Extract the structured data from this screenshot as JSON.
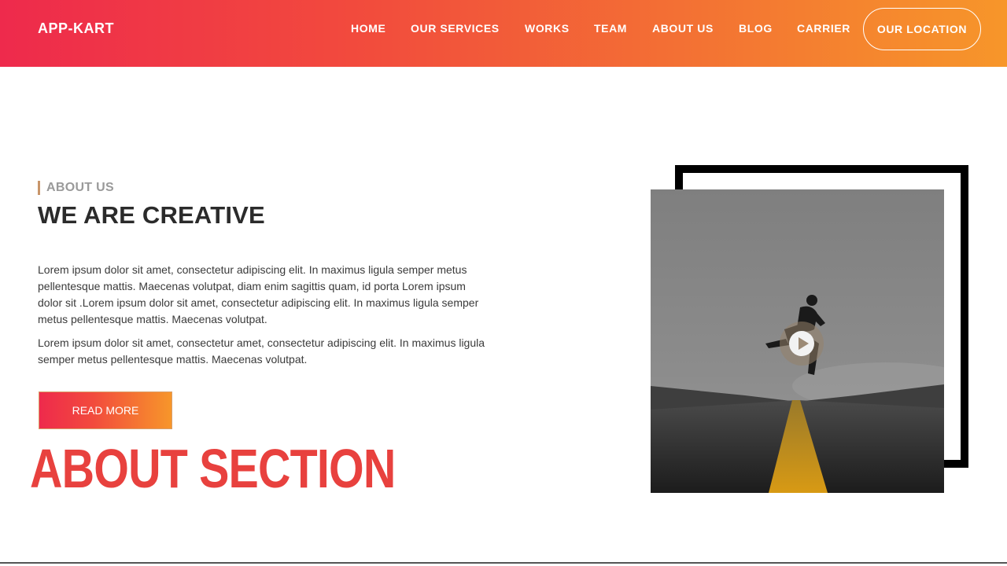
{
  "header": {
    "brand": "APP-KART",
    "nav": [
      {
        "label": "HOME"
      },
      {
        "label": "OUR SERVICES"
      },
      {
        "label": "WORKS"
      },
      {
        "label": "TEAM"
      },
      {
        "label": "ABOUT US"
      },
      {
        "label": "BLOG"
      },
      {
        "label": "CARRIER"
      }
    ],
    "cta_label": "OUR LOCATION",
    "gradient": [
      "#ee2a4c",
      "#f7962a"
    ]
  },
  "about": {
    "eyebrow": "ABOUT US",
    "heading_light": "WE ARE ",
    "heading_bold": "CREATIVE",
    "paragraph_1": "Lorem ipsum dolor sit amet, consectetur adipiscing elit. In maximus ligula semper metus pellentesque mattis. Maecenas volutpat, diam enim sagittis quam, id porta Lorem ipsum dolor sit .Lorem ipsum dolor sit amet, consectetur adipiscing elit. In maximus ligula semper metus pellentesque mattis. Maecenas volutpat.",
    "paragraph_2": "Lorem ipsum dolor sit amet, consectetur amet, consectetur adipiscing elit. In maximus ligula semper metus pellentesque mattis. Maecenas volutpat.",
    "button_label": "READ MORE"
  },
  "overlay_title": "ABOUT SECTION",
  "media": {
    "icon": "play-icon"
  },
  "colors": {
    "accent": "#e8413e",
    "eyebrow_bar": "#c8956a"
  }
}
